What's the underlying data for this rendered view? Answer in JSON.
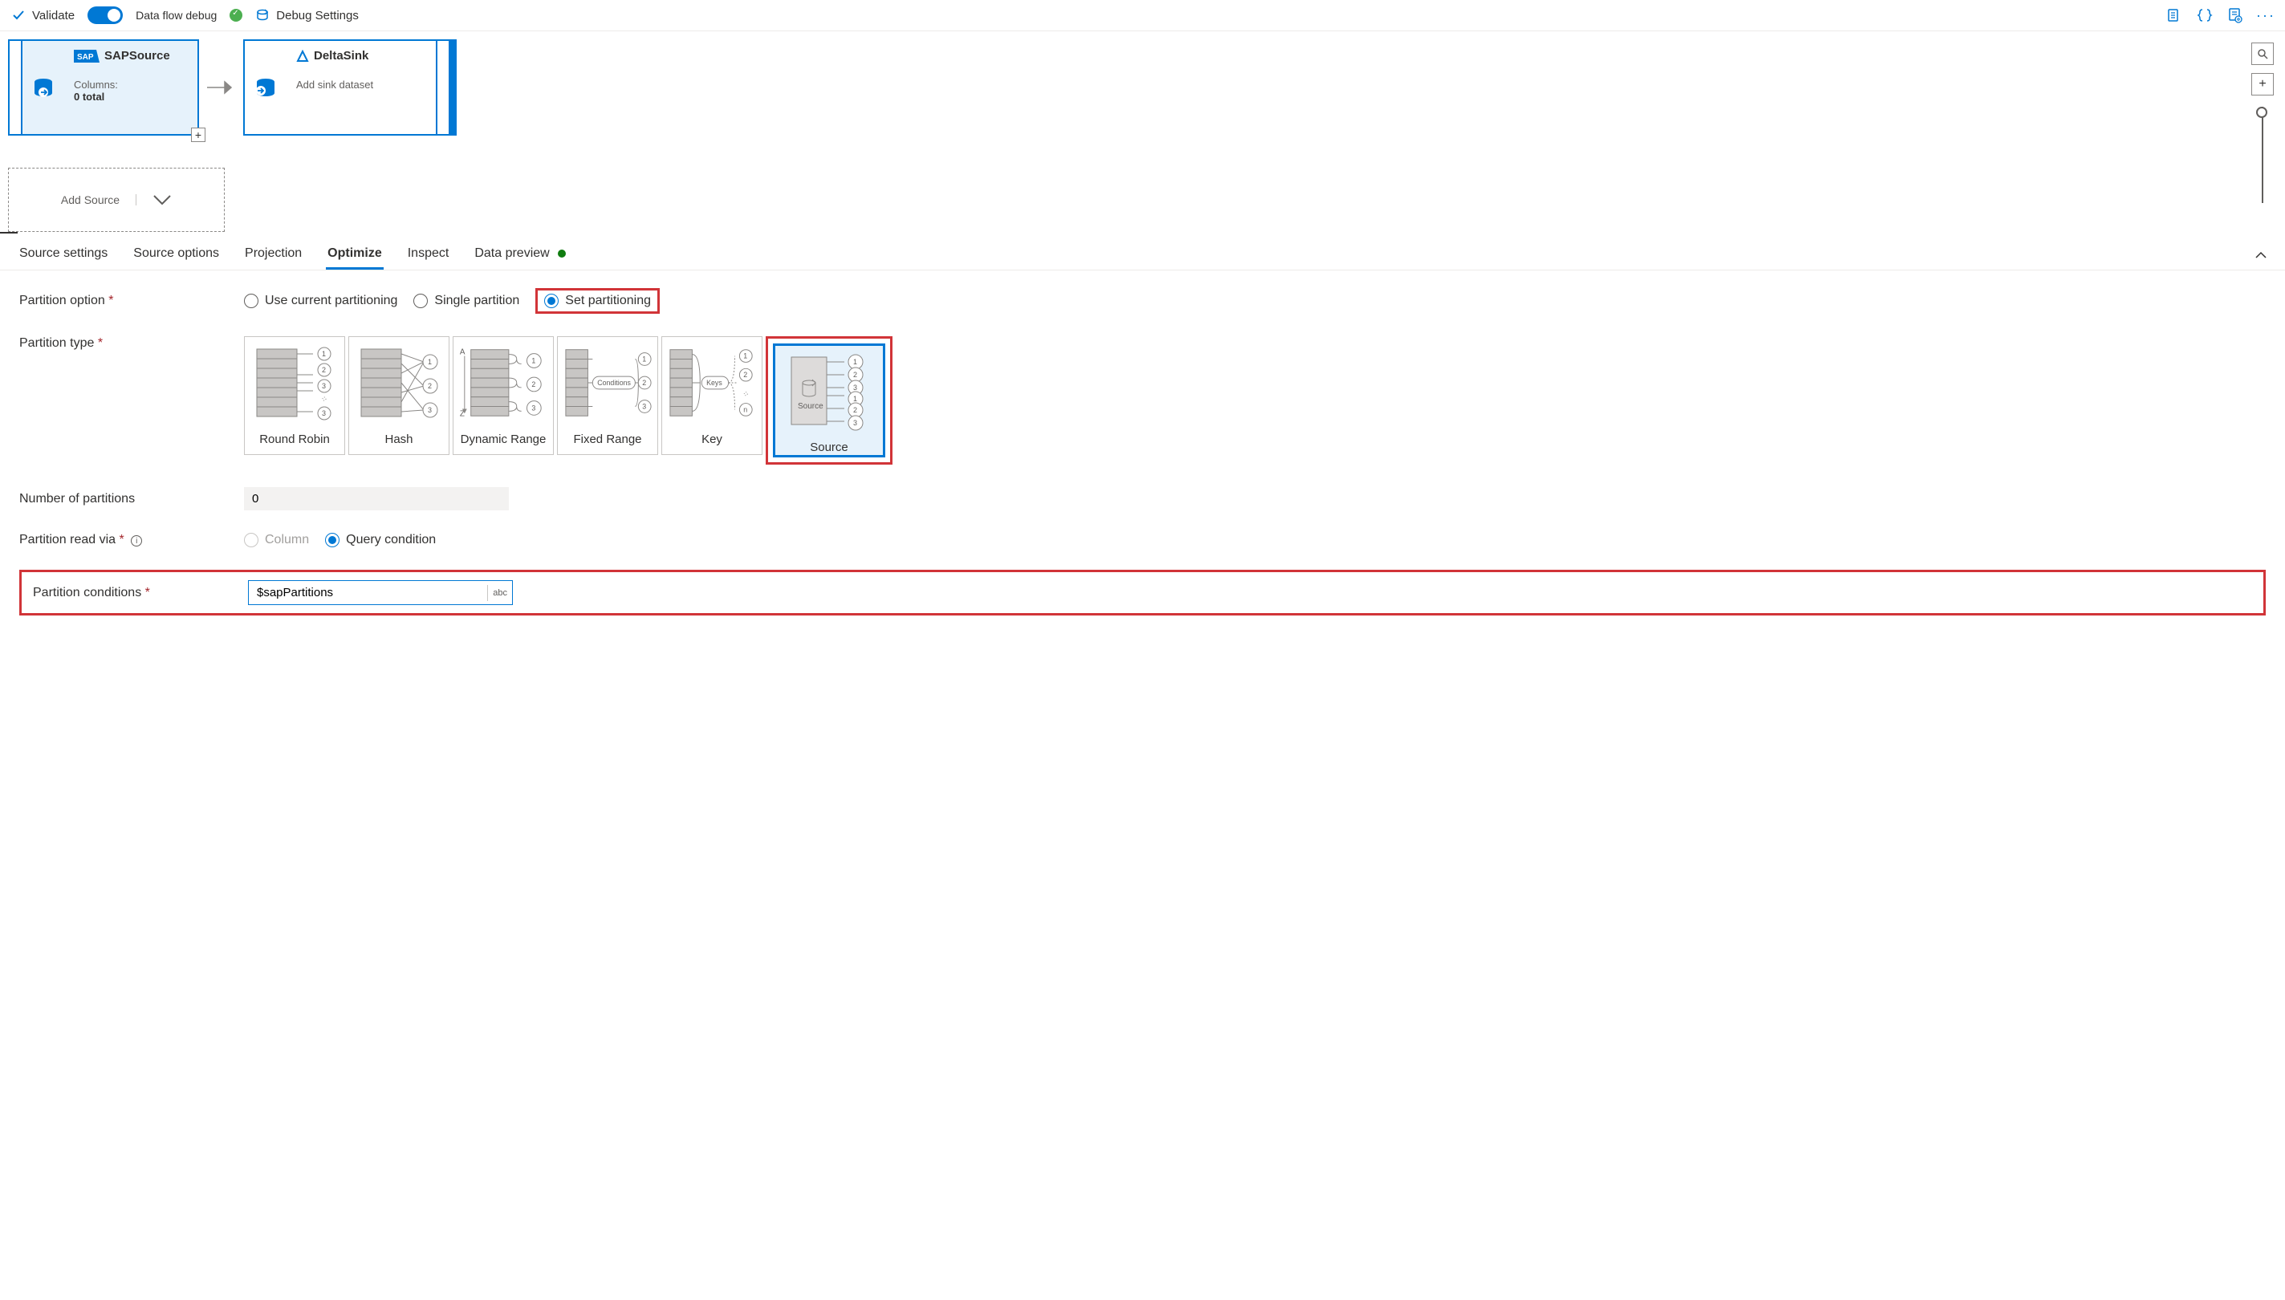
{
  "toolbar": {
    "validate": "Validate",
    "debug_label": "Data flow debug",
    "debug_settings": "Debug Settings"
  },
  "canvas": {
    "source_node": {
      "title": "SAPSource",
      "columns_label": "Columns:",
      "columns_count": "0 total"
    },
    "sink_node": {
      "title": "DeltaSink",
      "sub": "Add sink dataset"
    },
    "add_source": "Add Source"
  },
  "tabs": {
    "t0": "Source settings",
    "t1": "Source options",
    "t2": "Projection",
    "t3": "Optimize",
    "t4": "Inspect",
    "t5": "Data preview"
  },
  "form": {
    "partition_option_label": "Partition option",
    "opt_current": "Use current partitioning",
    "opt_single": "Single partition",
    "opt_set": "Set partitioning",
    "partition_type_label": "Partition type",
    "ptypes": {
      "p0": "Round Robin",
      "p1": "Hash",
      "p2": "Dynamic Range",
      "p3": "Fixed Range",
      "p4": "Key",
      "p5": "Source"
    },
    "num_partitions_label": "Number of partitions",
    "num_partitions_value": "0",
    "read_via_label": "Partition read via",
    "read_via_column": "Column",
    "read_via_query": "Query condition",
    "conditions_label": "Partition conditions",
    "conditions_value": "$sapPartitions",
    "abc": "abc"
  },
  "ptype_svg_labels": {
    "conditions": "Conditions",
    "keys": "Keys",
    "source": "Source"
  }
}
